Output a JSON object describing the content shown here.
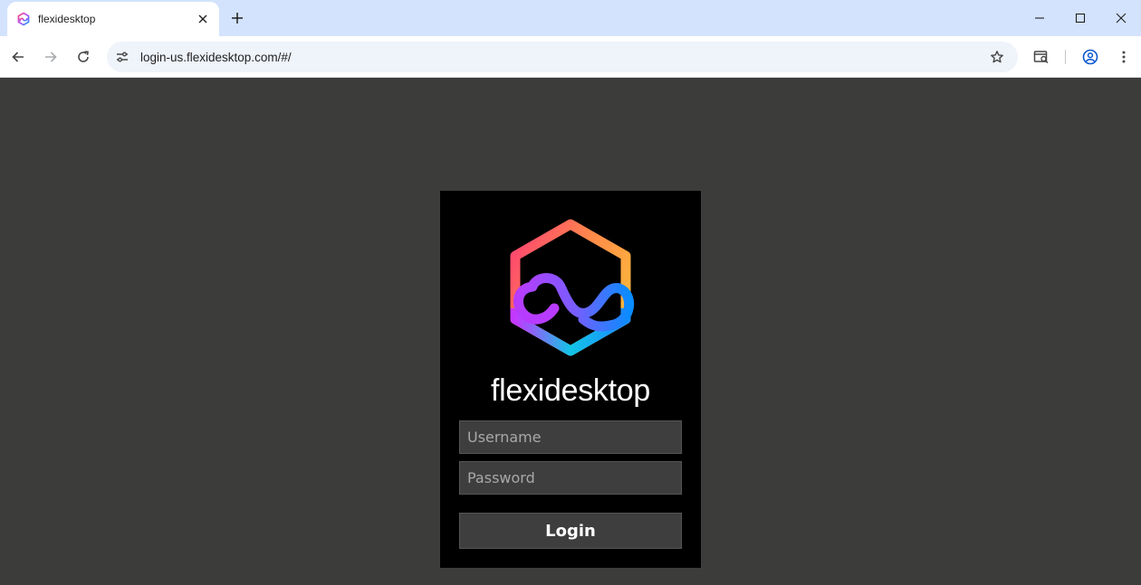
{
  "browser": {
    "tab_title": "flexidesktop",
    "url": "login-us.flexidesktop.com/#/"
  },
  "login": {
    "brand_name": "flexidesktop",
    "username_placeholder": "Username",
    "password_placeholder": "Password",
    "login_label": "Login"
  },
  "colors": {
    "page_background": "#3c3d3b",
    "card_background": "#000000",
    "field_background": "#3e3e3e",
    "tabstrip_background": "#d3e3fd"
  }
}
